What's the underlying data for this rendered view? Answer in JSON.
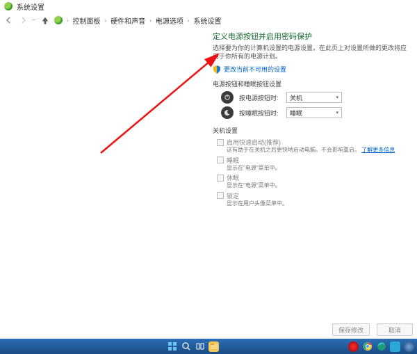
{
  "window": {
    "title": "系统设置"
  },
  "breadcrumb": {
    "root": "控制面板",
    "lvl1": "硬件和声音",
    "lvl2": "电源选项",
    "lvl3": "系统设置"
  },
  "page": {
    "title": "定义电源按钮并启用密码保护",
    "subtitle": "选择要为你的计算机设置的电源设置。在此页上对设置所做的更改将应用于你所有的电源计划。",
    "change_link": "更改当前不可用的设置",
    "section_buttons": "电源按钮和睡眠按钮设置",
    "power_btn": {
      "label": "按电源按钮时:",
      "value": "关机"
    },
    "sleep_btn": {
      "label": "按睡眠按钮时:",
      "value": "睡眠"
    },
    "shutdown_heading": "关机设置",
    "opts": [
      {
        "label": "启用快速启动(推荐)",
        "desc_a": "这有助于在关机之后更快地启动电脑。不会影响重启。",
        "desc_link": "了解更多信息"
      },
      {
        "label": "睡眠",
        "desc_a": "显示在\"电源\"菜单中。"
      },
      {
        "label": "休眠",
        "desc_a": "显示在\"电源\"菜单中。"
      },
      {
        "label": "锁定",
        "desc_a": "显示在用户头像菜单中。"
      }
    ]
  },
  "buttons": {
    "save": "保存修改",
    "cancel": "取消"
  }
}
